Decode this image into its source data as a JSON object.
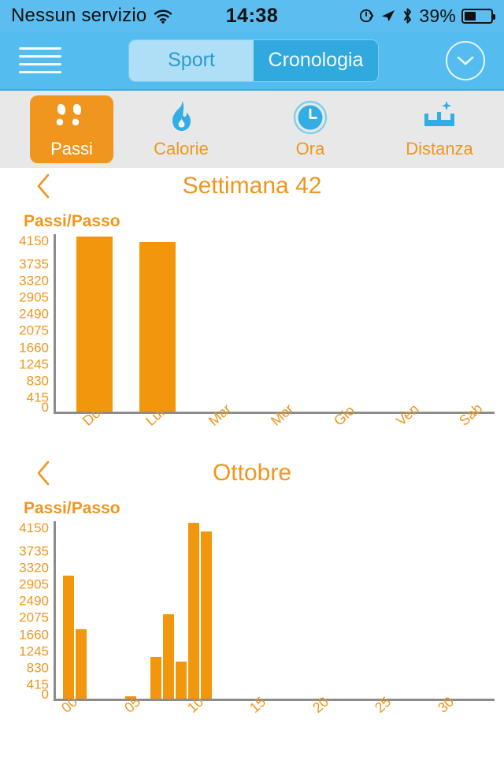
{
  "statusbar": {
    "carrier": "Nessun servizio",
    "wifi_icon": "wifi-icon",
    "time": "14:38",
    "rotation_lock_icon": "rotation-lock-icon",
    "location_icon": "location-arrow-icon",
    "bluetooth_icon": "bluetooth-icon",
    "battery_percent": "39%",
    "battery_icon": "battery-icon",
    "bg_color": "#5BBDF0"
  },
  "navbar": {
    "menu_icon": "hamburger-menu-icon",
    "segments": [
      {
        "label": "Sport",
        "selected": true
      },
      {
        "label": "Cronologia",
        "selected": false
      }
    ],
    "expand_icon": "chevron-down-circle-icon",
    "bg_color": "#55BCF0",
    "active_seg_color": "#AEDFF6",
    "inactive_seg_color": "#30A9DF"
  },
  "tabbar": {
    "bg_color": "#E8E8E8",
    "accent_color": "#F0961E",
    "icon_color": "#33AEE5",
    "tabs": [
      {
        "label": "Passi",
        "icon": "footprints-icon",
        "selected": true
      },
      {
        "label": "Calorie",
        "icon": "flame-icon",
        "selected": false
      },
      {
        "label": "Ora",
        "icon": "clock-icon",
        "selected": false
      },
      {
        "label": "Distanza",
        "icon": "ruler-icon",
        "selected": false
      }
    ]
  },
  "chart_data": [
    {
      "type": "bar",
      "title": "Settimana 42",
      "back_icon": "chevron-left-icon",
      "ylabel": "Passi/Passo",
      "xlabel": "",
      "categories": [
        "Dom",
        "Lun",
        "Mar",
        "Mer",
        "Gio",
        "Ven",
        "Sab"
      ],
      "values": [
        4095,
        3965,
        0,
        0,
        0,
        0,
        0
      ],
      "yticks": [
        4150,
        3735,
        3320,
        2905,
        2490,
        2075,
        1660,
        1245,
        830,
        415,
        0
      ],
      "ylim": [
        0,
        4150
      ],
      "grid": false,
      "legend": "none",
      "bar_color": "#F2960B",
      "axis_color": "#8C8C8C",
      "tick_color": "#F0961E"
    },
    {
      "type": "bar",
      "title": "Ottobre",
      "back_icon": "chevron-left-icon",
      "ylabel": "Passi/Passo",
      "xlabel": "",
      "x": [
        1,
        2,
        3,
        4,
        5,
        6,
        7,
        8,
        9,
        10,
        11,
        12,
        13,
        14,
        15,
        16,
        17,
        18,
        19,
        20,
        21,
        22,
        23,
        24,
        25,
        26,
        27,
        28,
        29,
        30,
        31
      ],
      "values": [
        2870,
        1630,
        0,
        0,
        0,
        60,
        0,
        980,
        1980,
        870,
        4110,
        3910,
        0,
        0,
        0,
        0,
        0,
        0,
        0,
        0,
        0,
        0,
        0,
        0,
        0,
        0,
        0,
        0,
        0,
        0,
        0
      ],
      "xticks": [
        "00",
        "05",
        "10",
        "15",
        "20",
        "25",
        "30"
      ],
      "xtick_values": [
        0,
        5,
        10,
        15,
        20,
        25,
        30
      ],
      "yticks": [
        4150,
        3735,
        3320,
        2905,
        2490,
        2075,
        1660,
        1245,
        830,
        415,
        0
      ],
      "ylim": [
        0,
        4150
      ],
      "xlim": [
        0,
        31
      ],
      "grid": false,
      "legend": "none",
      "bar_color": "#F2960B",
      "axis_color": "#8C8C8C",
      "tick_color": "#F0961E"
    }
  ]
}
